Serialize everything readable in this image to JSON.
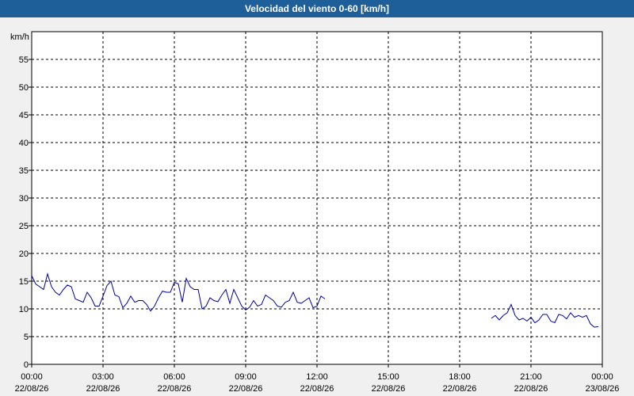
{
  "window": {
    "title": "Velocidad del viento 0-60 [km/h]"
  },
  "chart_data": {
    "type": "line",
    "title": "Velocidad del viento 0-60 [km/h]",
    "ylabel": "km/h",
    "ylim": [
      0,
      60
    ],
    "yticks": [
      0,
      5,
      10,
      15,
      20,
      25,
      30,
      35,
      40,
      45,
      50,
      55
    ],
    "xlim": [
      "2022-08-26T00:00",
      "2022-08-27T00:00"
    ],
    "xticks": [
      {
        "time": "00:00",
        "date": "22/08/26"
      },
      {
        "time": "03:00",
        "date": "22/08/26"
      },
      {
        "time": "06:00",
        "date": "22/08/26"
      },
      {
        "time": "09:00",
        "date": "22/08/26"
      },
      {
        "time": "12:00",
        "date": "22/08/26"
      },
      {
        "time": "15:00",
        "date": "22/08/26"
      },
      {
        "time": "18:00",
        "date": "22/08/26"
      },
      {
        "time": "21:00",
        "date": "22/08/26"
      },
      {
        "time": "00:00",
        "date": "23/08/26"
      }
    ],
    "grid": true,
    "line_color": "#0000a0",
    "series": [
      {
        "segments": [
          [
            [
              "00:00",
              16.0
            ],
            [
              "00:10",
              14.5
            ],
            [
              "00:20",
              14.0
            ],
            [
              "00:30",
              13.5
            ],
            [
              "00:40",
              16.3
            ],
            [
              "00:50",
              14.0
            ],
            [
              "01:00",
              13.0
            ],
            [
              "01:10",
              12.5
            ],
            [
              "01:20",
              13.5
            ],
            [
              "01:30",
              14.3
            ],
            [
              "01:40",
              14.0
            ],
            [
              "01:50",
              11.8
            ],
            [
              "02:00",
              11.5
            ],
            [
              "02:10",
              11.2
            ],
            [
              "02:20",
              13.0
            ],
            [
              "02:30",
              12.0
            ],
            [
              "02:40",
              10.5
            ],
            [
              "02:50",
              10.5
            ],
            [
              "03:00",
              12.3
            ],
            [
              "03:10",
              14.2
            ],
            [
              "03:20",
              15.0
            ],
            [
              "03:30",
              12.5
            ],
            [
              "03:40",
              12.2
            ],
            [
              "03:50",
              10.2
            ],
            [
              "04:00",
              11.0
            ],
            [
              "04:10",
              12.3
            ],
            [
              "04:20",
              11.2
            ],
            [
              "04:30",
              11.5
            ],
            [
              "04:40",
              11.5
            ],
            [
              "04:50",
              10.8
            ],
            [
              "05:00",
              9.6
            ],
            [
              "05:10",
              10.5
            ],
            [
              "05:20",
              12.0
            ],
            [
              "05:30",
              13.2
            ],
            [
              "05:40",
              13.0
            ],
            [
              "05:50",
              13.0
            ],
            [
              "06:00",
              14.8
            ],
            [
              "06:10",
              14.5
            ],
            [
              "06:20",
              11.2
            ],
            [
              "06:30",
              15.5
            ],
            [
              "06:40",
              14.0
            ],
            [
              "06:50",
              13.5
            ],
            [
              "07:00",
              13.5
            ],
            [
              "07:10",
              10.0
            ],
            [
              "07:20",
              10.5
            ],
            [
              "07:30",
              12.0
            ],
            [
              "07:40",
              11.5
            ],
            [
              "07:50",
              11.3
            ],
            [
              "08:00",
              12.5
            ],
            [
              "08:10",
              13.5
            ],
            [
              "08:20",
              11.0
            ],
            [
              "08:30",
              13.5
            ],
            [
              "08:40",
              12.0
            ],
            [
              "08:50",
              10.5
            ],
            [
              "09:00",
              9.8
            ],
            [
              "09:10",
              10.3
            ],
            [
              "09:20",
              11.5
            ],
            [
              "09:30",
              10.5
            ],
            [
              "09:40",
              10.8
            ],
            [
              "09:50",
              12.5
            ],
            [
              "10:00",
              12.0
            ],
            [
              "10:10",
              11.5
            ],
            [
              "10:20",
              10.5
            ],
            [
              "10:30",
              10.3
            ],
            [
              "10:40",
              11.2
            ],
            [
              "10:50",
              11.5
            ],
            [
              "11:00",
              13.0
            ],
            [
              "11:10",
              11.2
            ],
            [
              "11:20",
              11.0
            ],
            [
              "11:30",
              11.5
            ],
            [
              "11:40",
              12.0
            ],
            [
              "11:50",
              10.2
            ],
            [
              "12:00",
              10.5
            ],
            [
              "12:10",
              12.3
            ],
            [
              "12:20",
              11.8
            ]
          ],
          [
            [
              "19:20",
              8.3
            ],
            [
              "19:30",
              8.8
            ],
            [
              "19:40",
              8.0
            ],
            [
              "19:50",
              8.8
            ],
            [
              "20:00",
              9.3
            ],
            [
              "20:10",
              10.8
            ],
            [
              "20:20",
              8.8
            ],
            [
              "20:30",
              8.0
            ],
            [
              "20:40",
              8.3
            ],
            [
              "20:50",
              7.8
            ],
            [
              "21:00",
              8.5
            ],
            [
              "21:10",
              7.5
            ],
            [
              "21:20",
              8.0
            ],
            [
              "21:30",
              9.0
            ],
            [
              "21:40",
              9.0
            ],
            [
              "21:50",
              7.8
            ],
            [
              "22:00",
              7.5
            ],
            [
              "22:10",
              9.0
            ],
            [
              "22:20",
              8.8
            ],
            [
              "22:30",
              8.2
            ],
            [
              "22:40",
              9.3
            ],
            [
              "22:50",
              8.5
            ],
            [
              "23:00",
              8.8
            ],
            [
              "23:10",
              8.5
            ],
            [
              "23:20",
              8.8
            ],
            [
              "23:30",
              7.3
            ],
            [
              "23:40",
              6.7
            ],
            [
              "23:50",
              6.8
            ]
          ]
        ]
      }
    ]
  }
}
